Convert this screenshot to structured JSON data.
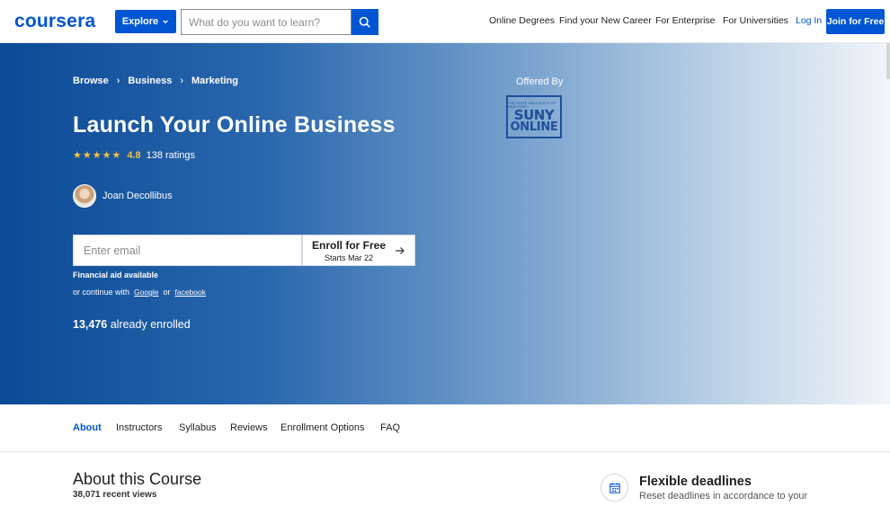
{
  "header": {
    "logo": "coursera",
    "explore_label": "Explore",
    "search_placeholder": "What do you want to learn?",
    "nav": [
      "Online Degrees",
      "Find your New Career",
      "For Enterprise",
      "For Universities"
    ],
    "login_label": "Log In",
    "join_label": "Join for Free",
    "brand_color": "#0056d2"
  },
  "hero": {
    "breadcrumb": [
      "Browse",
      "Business",
      "Marketing"
    ],
    "title": "Launch Your Online Business",
    "rating": "4.8",
    "rating_count": "138 ratings",
    "stars": "★★★★★",
    "instructor": "Joan Decollibus",
    "email_placeholder": "Enter email",
    "enroll_label": "Enroll for Free",
    "enroll_sub": "Starts Mar 22",
    "financial_aid": "Financial aid available",
    "continue_prefix": "or continue with",
    "continue_google": "Google",
    "continue_or": "or",
    "continue_facebook": "facebook",
    "enrolled_count": "13,476",
    "enrolled_suffix": "already enrolled",
    "offered_by": "Offered By",
    "partner_logo": {
      "top_text": "THE STATE UNIVERSITY OF NEW YORK",
      "line1": "SUNY",
      "line2": "ONLINE"
    }
  },
  "tabs": [
    "About",
    "Instructors",
    "Syllabus",
    "Reviews",
    "Enrollment Options",
    "FAQ"
  ],
  "about": {
    "title": "About this Course",
    "recent_views": "38,071 recent views"
  },
  "feature": {
    "icon": "calendar-icon",
    "title": "Flexible deadlines",
    "description": "Reset deadlines in accordance to your"
  }
}
